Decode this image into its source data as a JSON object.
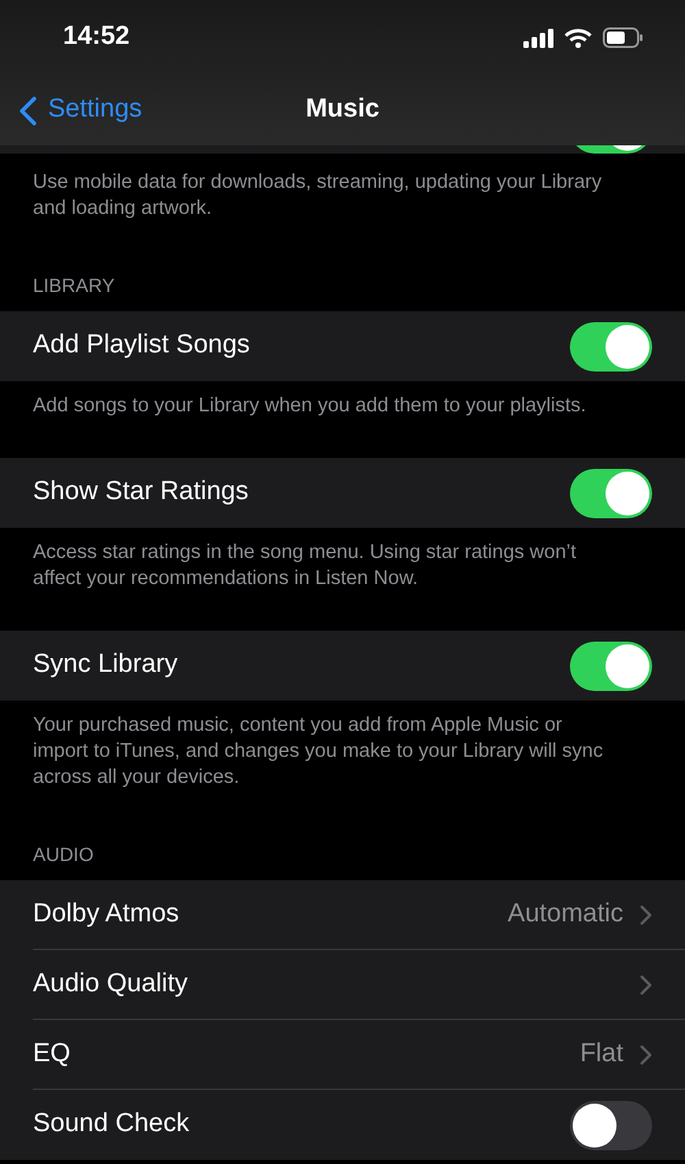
{
  "status_bar": {
    "time": "14:52"
  },
  "nav": {
    "back": "Settings",
    "title": "Music"
  },
  "hidden_row": {
    "on": true
  },
  "sections": [
    {
      "footer": "Use mobile data for downloads, streaming, updating your Library and loading artwork."
    },
    {
      "header": "LIBRARY",
      "rows": [
        {
          "kind": "toggle",
          "label": "Add Playlist Songs",
          "on": true
        }
      ],
      "footer": "Add songs to your Library when you add them to your playlists."
    },
    {
      "rows": [
        {
          "kind": "toggle",
          "label": "Show Star Ratings",
          "on": true
        }
      ],
      "footer": "Access star ratings in the song menu. Using star ratings won’t affect your recommendations in Listen Now."
    },
    {
      "rows": [
        {
          "kind": "toggle",
          "label": "Sync Library",
          "on": true
        }
      ],
      "footer": "Your purchased music, content you add from Apple Music or import to iTunes, and changes you make to your Library will sync across all your devices."
    },
    {
      "header": "AUDIO",
      "rows": [
        {
          "kind": "link",
          "label": "Dolby Atmos",
          "value": "Automatic"
        },
        {
          "kind": "link",
          "label": "Audio Quality"
        },
        {
          "kind": "link",
          "label": "EQ",
          "value": "Flat"
        },
        {
          "kind": "toggle",
          "label": "Sound Check",
          "on": false
        }
      ]
    }
  ]
}
